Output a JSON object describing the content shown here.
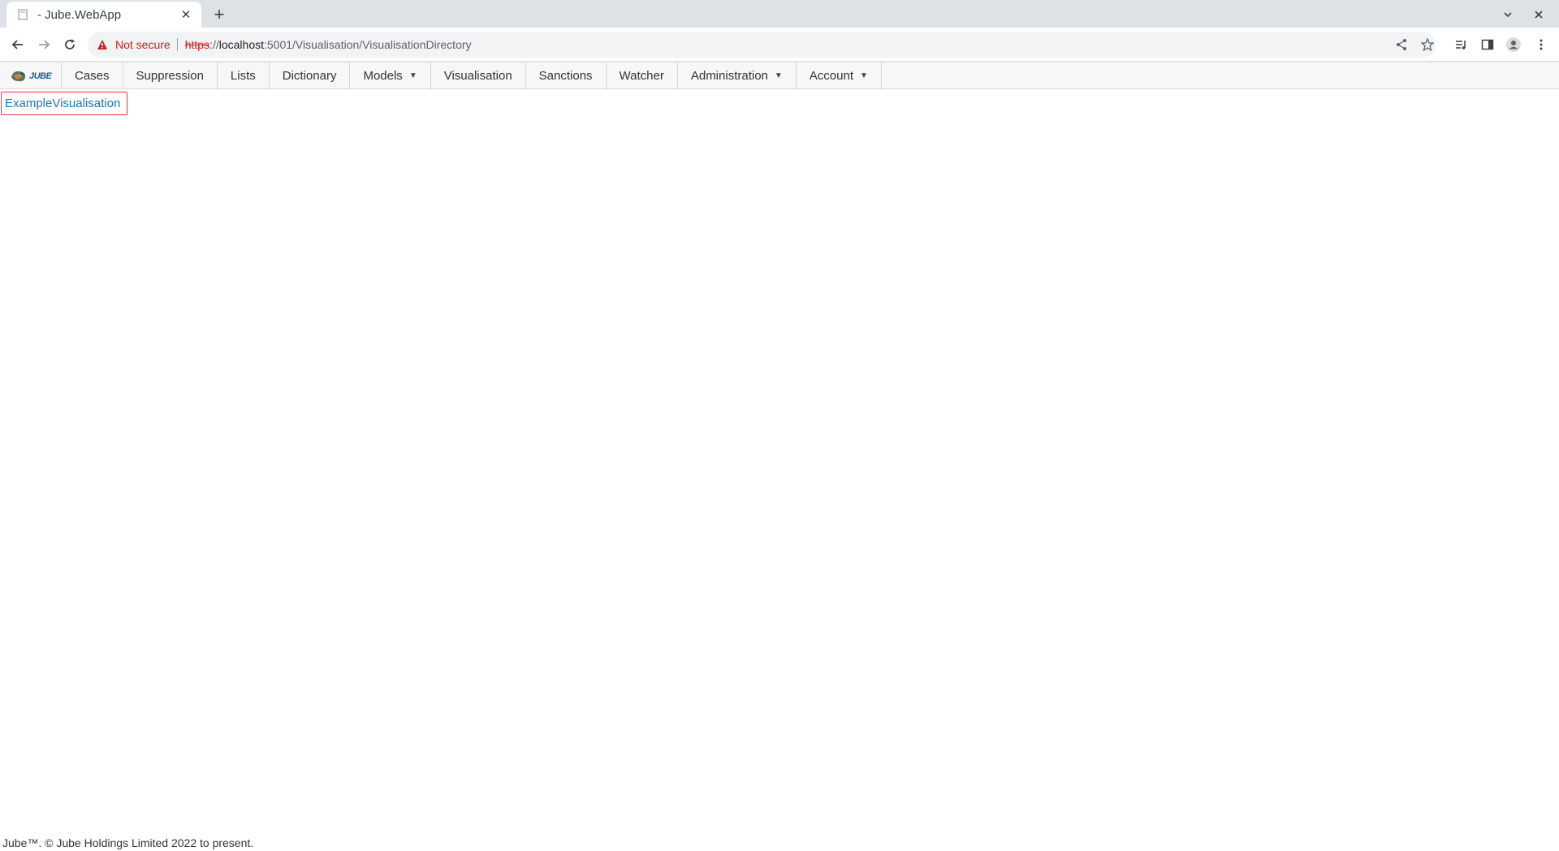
{
  "browser": {
    "tab_title": "- Jube.WebApp",
    "tab_close_glyph": "✕",
    "new_tab_glyph": "+",
    "security_label": "Not secure",
    "url_scheme": "https",
    "url_sep": "://",
    "url_host": "localhost",
    "url_rest": ":5001/Visualisation/VisualisationDirectory"
  },
  "nav": {
    "logo_text": "JUBE",
    "items": [
      {
        "label": "Cases"
      },
      {
        "label": "Suppression"
      },
      {
        "label": "Lists"
      },
      {
        "label": "Dictionary"
      },
      {
        "label": "Models",
        "dropdown": true
      },
      {
        "label": "Visualisation"
      },
      {
        "label": "Sanctions"
      },
      {
        "label": "Watcher"
      },
      {
        "label": "Administration",
        "dropdown": true
      },
      {
        "label": "Account",
        "dropdown": true
      }
    ]
  },
  "content": {
    "directory_item": "ExampleVisualisation"
  },
  "footer": {
    "text": "Jube™. © Jube Holdings Limited 2022 to present."
  },
  "colors": {
    "link": "#1e74b8",
    "highlight_border": "#e03a3a",
    "not_secure": "#c5221f"
  }
}
